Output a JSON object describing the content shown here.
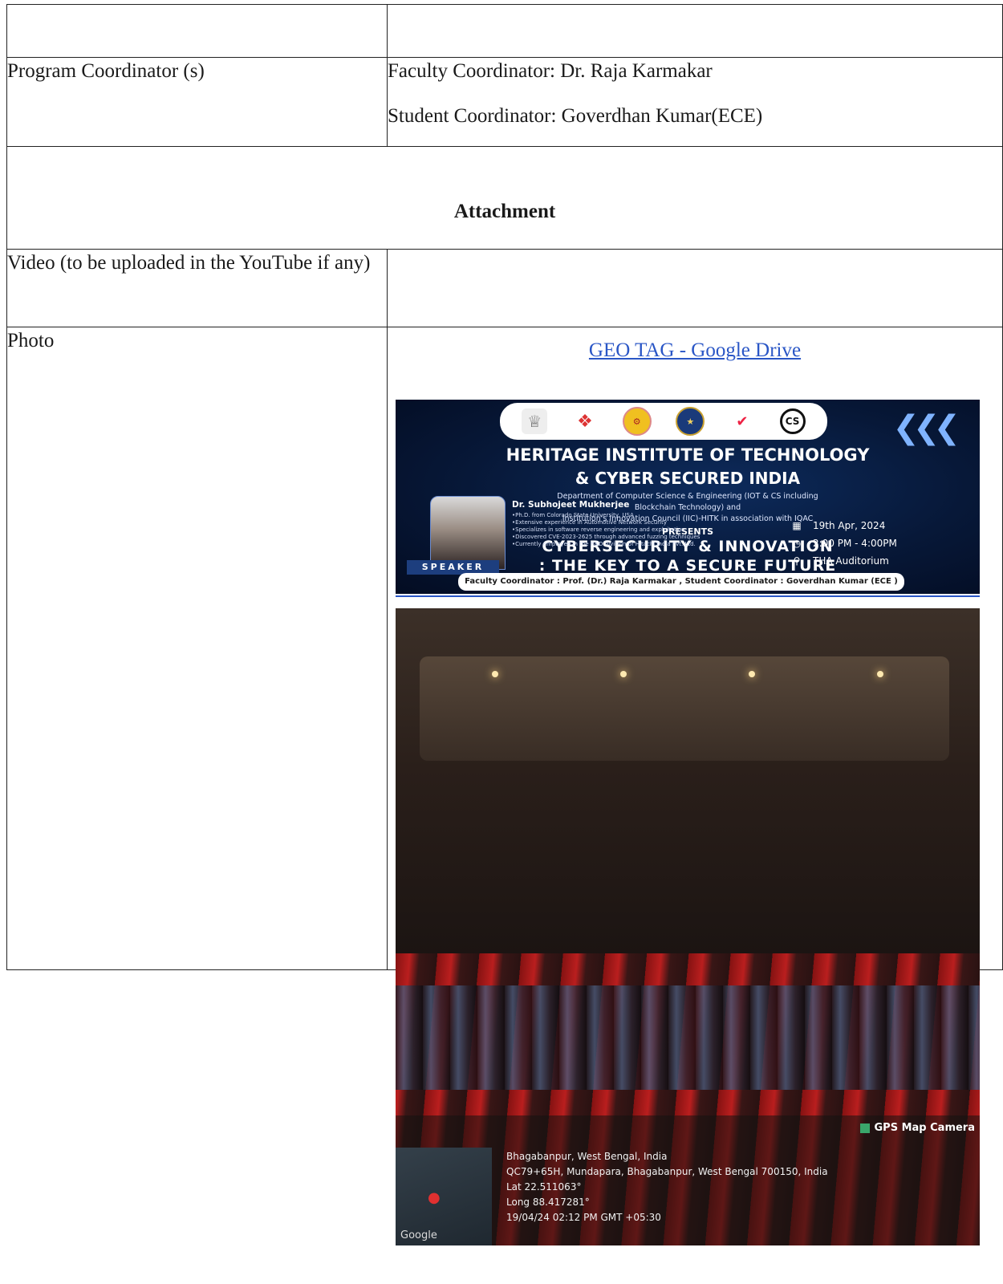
{
  "rows": {
    "coordinators_label": "Program Coordinator (s)",
    "faculty_coordinator": "Faculty Coordinator: Dr. Raja Karmakar",
    "student_coordinator": "Student Coordinator: Goverdhan Kumar(ECE)",
    "attachment_heading": "Attachment",
    "video_label": "Video (to be uploaded in the YouTube if any)",
    "photo_label": "Photo",
    "photo_link": "GEO TAG - Google Drive"
  },
  "poster": {
    "title_line1": "HERITAGE INSTITUTE OF TECHNOLOGY",
    "title_line2": "& CYBER SECURED INDIA",
    "dept_line1": "Department of Computer Science & Engineering (IOT & CS including",
    "dept_line2": "Blockchain Technology) and",
    "dept_line3": "Institution's Innovation Council (IIC)-HITK in association with IQAC",
    "presents": "PRESENTS",
    "event_line1": "CYBERSECURITY & INNOVATION",
    "event_line2": ": THE KEY TO A SECURE FUTURE",
    "speaker_name": "Dr. Subhojeet Mukherjee",
    "speaker_bullets": [
      "Ph.D. from Colorado State University, USA",
      "Extensive experience in Automotive Network Security",
      "Specializes in software reverse engineering and exploitation",
      "Discovered CVE-2023-2625 through advanced fuzzing techniques",
      "Currently employee in the R&D division of Hitachi India Pvt. Ltd."
    ],
    "speaker_badge": "SPEAKER",
    "date": "19th Apr, 2024",
    "time": "2:00 PM - 4:00PM",
    "venue": "THA Auditorium",
    "footer": "Faculty Coordinator : Prof. (Dr.) Raja Karmakar , Student Coordinator : Goverdhan Kumar (ECE )",
    "logo_cs": "CS",
    "icons": [
      "calendar-icon",
      "clock-icon",
      "location-pin-icon"
    ]
  },
  "photo": {
    "gps_app": "GPS Map Camera",
    "map_brand": "Google",
    "location_title": "Bhagabanpur, West Bengal, India",
    "address": "QC79+65H, Mundapara, Bhagabanpur, West Bengal 700150, India",
    "lat": "Lat 22.511063°",
    "long": "Long 88.417281°",
    "timestamp": "19/04/24 02:12 PM GMT +05:30"
  },
  "colors": {
    "link": "#2a56c6",
    "poster_bg": "#071838",
    "border": "#222222"
  }
}
